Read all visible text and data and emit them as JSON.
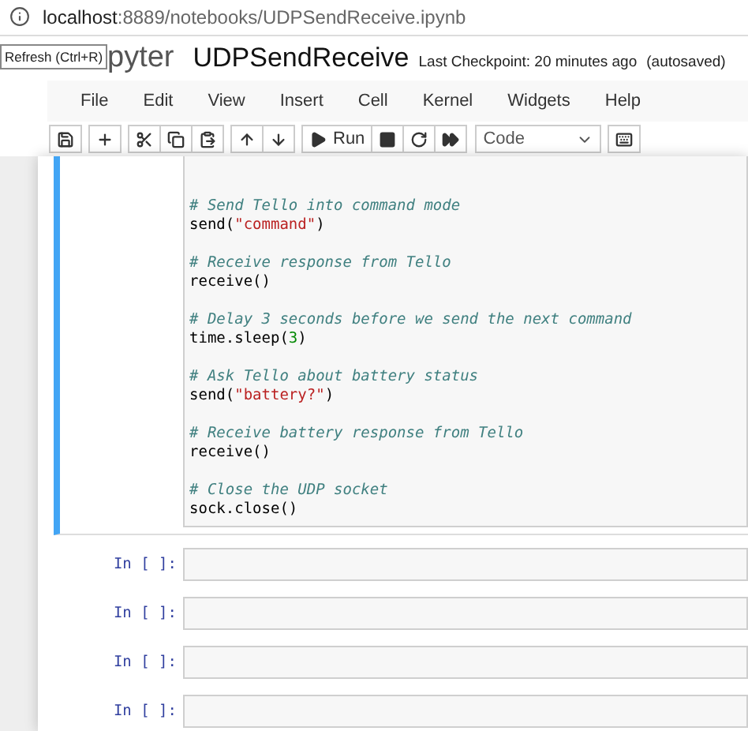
{
  "address_bar": {
    "host": "localhost",
    "path": ":8889/notebooks/UDPSendReceive.ipynb"
  },
  "tooltip": "Refresh (Ctrl+R)",
  "header": {
    "logo": "pyter",
    "title": "UDPSendReceive",
    "checkpoint": "Last Checkpoint: 20 minutes ago",
    "autosave": "(autosaved)"
  },
  "menu": [
    "File",
    "Edit",
    "View",
    "Insert",
    "Cell",
    "Kernel",
    "Widgets",
    "Help"
  ],
  "toolbar": [
    {
      "kind": "group",
      "buttons": [
        {
          "kind": "save"
        }
      ]
    },
    {
      "kind": "group",
      "buttons": [
        {
          "kind": "insert"
        }
      ]
    },
    {
      "kind": "group",
      "buttons": [
        {
          "kind": "cut"
        },
        {
          "kind": "copy"
        },
        {
          "kind": "paste"
        }
      ]
    },
    {
      "kind": "group",
      "buttons": [
        {
          "kind": "up"
        },
        {
          "kind": "down"
        }
      ]
    },
    {
      "kind": "group",
      "buttons": [
        {
          "kind": "run",
          "label": "Run"
        },
        {
          "kind": "stop"
        },
        {
          "kind": "restart"
        },
        {
          "kind": "run_all"
        }
      ]
    },
    {
      "kind": "select",
      "value": "Code"
    },
    {
      "kind": "group",
      "buttons": [
        {
          "kind": "keyboard"
        }
      ]
    }
  ],
  "cells": [
    {
      "kind": "code",
      "selected": true,
      "blocks": [
        [
          [
            {
              "kind": "comment",
              "text": "# Send Tello into command mode"
            }
          ],
          [
            {
              "kind": "plain",
              "text": "send("
            },
            {
              "kind": "string",
              "text": "\"command\""
            },
            {
              "kind": "plain",
              "text": ")"
            }
          ]
        ],
        [
          [
            {
              "kind": "comment",
              "text": "# Receive response from Tello"
            }
          ],
          [
            {
              "kind": "plain",
              "text": "receive()"
            }
          ]
        ],
        [
          [
            {
              "kind": "comment",
              "text": "# Delay 3 seconds before we send the next command"
            }
          ],
          [
            {
              "kind": "plain",
              "text": "time.sleep("
            },
            {
              "kind": "number",
              "text": "3"
            },
            {
              "kind": "plain",
              "text": ")"
            }
          ]
        ],
        [
          [
            {
              "kind": "comment",
              "text": "# Ask Tello about battery status"
            }
          ],
          [
            {
              "kind": "plain",
              "text": "send("
            },
            {
              "kind": "string",
              "text": "\"battery?\""
            },
            {
              "kind": "plain",
              "text": ")"
            }
          ]
        ],
        [
          [
            {
              "kind": "comment",
              "text": "# Receive battery response from Tello"
            }
          ],
          [
            {
              "kind": "plain",
              "text": "receive()"
            }
          ]
        ],
        [
          [
            {
              "kind": "comment",
              "text": "# Close the UDP socket"
            }
          ],
          [
            {
              "kind": "plain",
              "text": "sock.close()"
            }
          ]
        ]
      ]
    },
    {
      "kind": "empty",
      "selected": false,
      "prompt": "In [ ]:"
    },
    {
      "kind": "empty",
      "selected": false,
      "prompt": "In [ ]:"
    },
    {
      "kind": "empty",
      "selected": false,
      "prompt": "In [ ]:"
    },
    {
      "kind": "empty",
      "selected": false,
      "prompt": "In [ ]:"
    }
  ]
}
